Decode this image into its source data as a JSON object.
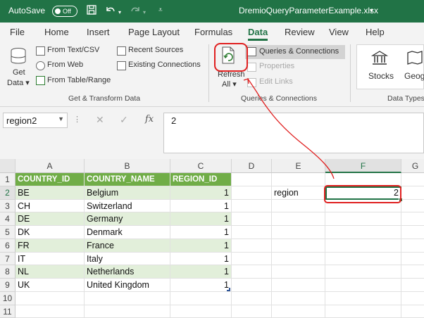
{
  "titlebar": {
    "autosave_label": "AutoSave",
    "autosave_state": "Off",
    "filename": "DremioQueryParameterExample.xlsx",
    "filename_caret": "▾"
  },
  "menu": {
    "tabs": [
      "File",
      "Home",
      "Insert",
      "Page Layout",
      "Formulas",
      "Data",
      "Review",
      "View",
      "Help"
    ],
    "active_tab": "Data"
  },
  "ribbon": {
    "get_data": {
      "line1": "Get",
      "line2": "Data ▾"
    },
    "from_text_csv": "From Text/CSV",
    "from_web": "From Web",
    "from_table_range": "From Table/Range",
    "recent_sources": "Recent Sources",
    "existing_connections": "Existing Connections",
    "group_get_transform": "Get & Transform Data",
    "refresh_all": {
      "line1": "Refresh",
      "line2": "All ▾"
    },
    "queries_connections": "Queries & Connections",
    "properties": "Properties",
    "edit_links": "Edit Links",
    "group_queries": "Queries & Connections",
    "stocks": "Stocks",
    "geography": "Geog",
    "group_data_types": "Data Types"
  },
  "formula_bar": {
    "name_box": "region2",
    "formula_value": "2",
    "fx_label": "fx"
  },
  "grid": {
    "columns": [
      "A",
      "B",
      "C",
      "D",
      "E",
      "F",
      "G"
    ],
    "selected_column": "F",
    "rows": [
      "1",
      "2",
      "3",
      "4",
      "5",
      "6",
      "7",
      "8",
      "9",
      "10",
      "11"
    ],
    "selected_row": "2",
    "table_headers": [
      "COUNTRY_ID",
      "COUNTRY_NAME",
      "REGION_ID"
    ],
    "table_rows": [
      [
        "BE",
        "Belgium",
        "1"
      ],
      [
        "CH",
        "Switzerland",
        "1"
      ],
      [
        "DE",
        "Germany",
        "1"
      ],
      [
        "DK",
        "Denmark",
        "1"
      ],
      [
        "FR",
        "France",
        "1"
      ],
      [
        "IT",
        "Italy",
        "1"
      ],
      [
        "NL",
        "Netherlands",
        "1"
      ],
      [
        "UK",
        "United Kingdom",
        "1"
      ]
    ],
    "label_cell": "region",
    "value_cell": "2"
  },
  "colors": {
    "excel_green": "#217346",
    "table_header": "#70ad47",
    "table_band": "#e2efda",
    "annotation_red": "#e02020"
  }
}
